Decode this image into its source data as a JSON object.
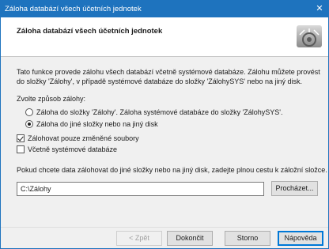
{
  "window": {
    "title": "Záloha databází všech účetních jednotek",
    "close_glyph": "✕"
  },
  "header": {
    "title": "Záloha databází všech účetních jednotek",
    "logo_icon": "gear-wizard-icon"
  },
  "intro": {
    "line1": "Tato funkce provede zálohu všech databází včetně systémové databáze. Zálohu můžete provést",
    "line2": "do složky 'Zálohy', v případě systémové databáze do složky 'ZálohySYS' nebo na jiný disk."
  },
  "backup_mode": {
    "label": "Zvolte způsob zálohy:",
    "options": [
      {
        "label": "Záloha do složky 'Zálohy'. Záloha systémové databáze do složky 'ZálohySYS'.",
        "selected": false
      },
      {
        "label": "Záloha do jiné složky nebo na jiný disk",
        "selected": true
      }
    ]
  },
  "options": {
    "changed_only": {
      "label": "Zálohovat pouze změněné soubory",
      "checked": true
    },
    "include_system": {
      "label": "Včetně systémové databáze",
      "checked": false
    }
  },
  "path": {
    "hint": "Pokud chcete data zálohovat do jiné složky nebo na jiný disk, zadejte plnou cestu k záložní složce.",
    "value": "C:\\Zálohy",
    "browse_label": "Procházet..."
  },
  "buttons": {
    "back": "< Zpět",
    "finish": "Dokončit",
    "cancel": "Storno",
    "help": "Nápověda"
  },
  "colors": {
    "titlebar": "#1e73be",
    "accent": "#0078d7"
  }
}
